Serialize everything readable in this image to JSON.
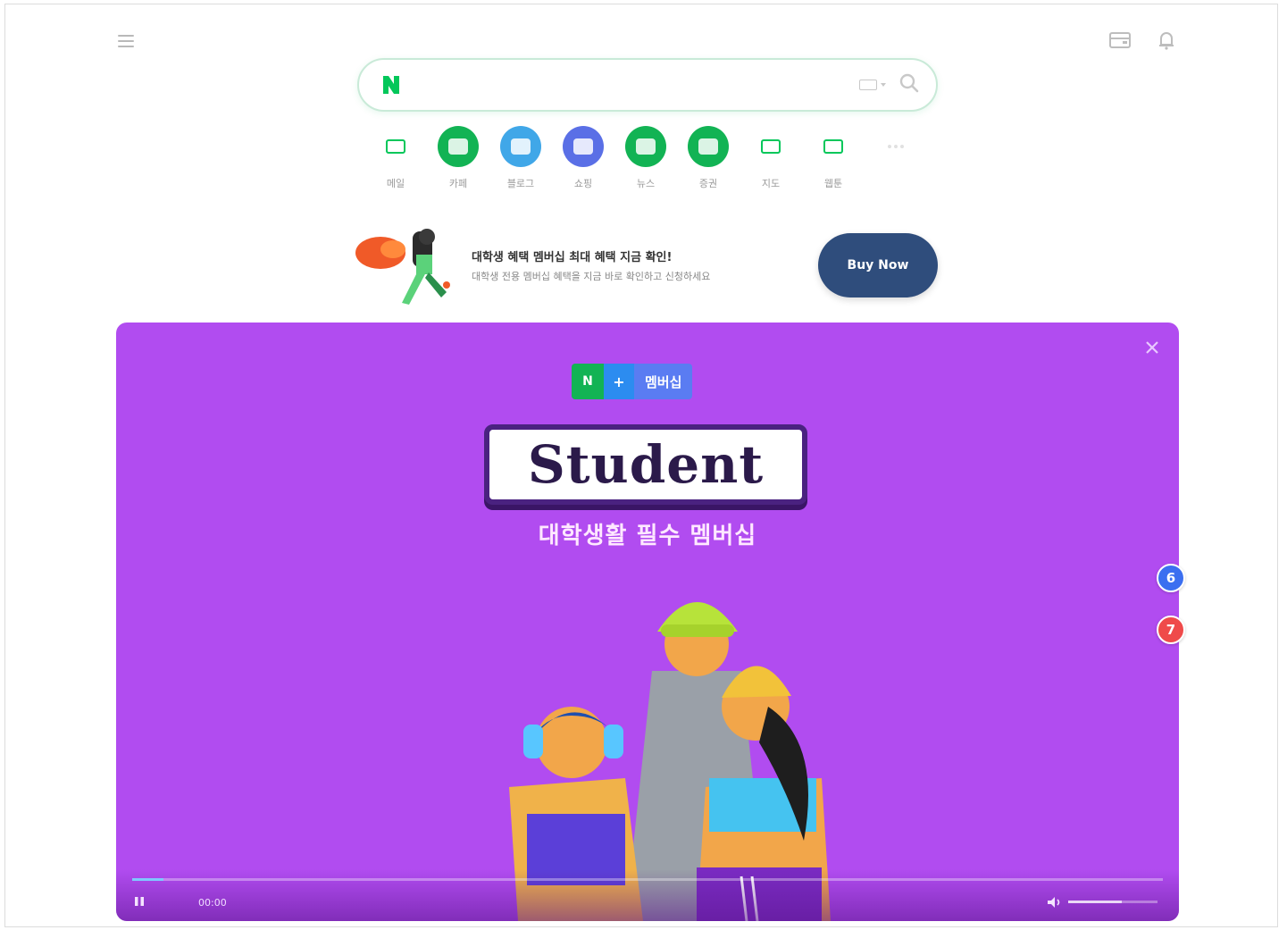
{
  "search": {
    "placeholder": "",
    "logo_letter": "N"
  },
  "shortcuts": [
    {
      "label": "메일",
      "color": "#ffffff",
      "icon": "mail-icon"
    },
    {
      "label": "카페",
      "color": "#12b354",
      "icon": "cafe-icon"
    },
    {
      "label": "블로그",
      "color": "#40a7e8",
      "icon": "blog-icon"
    },
    {
      "label": "쇼핑",
      "color": "#5a6fe6",
      "icon": "shopping-icon"
    },
    {
      "label": "뉴스",
      "color": "#12b354",
      "icon": "news-icon"
    },
    {
      "label": "증권",
      "color": "#12b354",
      "icon": "stock-icon"
    },
    {
      "label": "지도",
      "color": "#ffffff",
      "icon": "map-icon"
    },
    {
      "label": "웹툰",
      "color": "#ffffff",
      "icon": "webtoon-icon"
    },
    {
      "label": "",
      "color": "#ffffff",
      "icon": "more-icon"
    }
  ],
  "banner": {
    "title": "대학생 혜택 멤버십 최대 혜택 지금 확인!",
    "subtitle": "대학생 전용 멤버십 혜택을 지금 바로 확인하고 신청하세요",
    "cta": "Buy Now"
  },
  "ad": {
    "chip_a": "N",
    "chip_b": "+",
    "chip_c": "멤버십",
    "headline": "Student",
    "subtitle": "대학생활 필수 멤버십",
    "time": "00:00",
    "progress": 0.03,
    "volume": 0.6
  },
  "badges": {
    "six": "6",
    "seven": "7"
  },
  "colors": {
    "brand_green": "#03c75a",
    "ad_purple": "#b14cf0",
    "badge_blue": "#3b6ff0",
    "badge_red": "#ef4a4a"
  }
}
